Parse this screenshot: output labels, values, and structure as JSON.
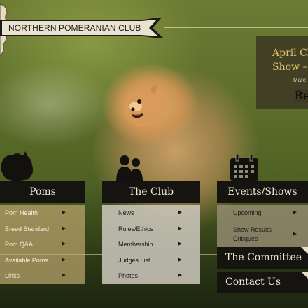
{
  "site": {
    "title": "NORTHERN POMERANIAN CLUB"
  },
  "event": {
    "title_line1": "April Ch",
    "title_line2": "Show –",
    "date": "Marc",
    "button": "Rea"
  },
  "menus": {
    "poms": {
      "label": "Poms",
      "items": [
        "Pom Health",
        "Breed Standard",
        "Pom Q&A",
        "Available Poms",
        "Links"
      ]
    },
    "club": {
      "label": "The Club",
      "items": [
        "News",
        "Rules/Ethics",
        "Membership",
        "Judges List",
        "Photos"
      ]
    },
    "events": {
      "label": "Events/Shows",
      "items": [
        "Upcoming",
        "Show Results Critiques"
      ]
    }
  },
  "blocks": {
    "committee": "The Committee",
    "contact": "Contact Us"
  },
  "arrow_glyph": "▶",
  "colors": {
    "dark": "#151410",
    "gold": "#e4c16a",
    "poms_bg": "#bea56e",
    "club_bg": "#cdc8be",
    "events_bg": "#968c73"
  },
  "icons": [
    "paw-logo-icon",
    "pomeranian-silhouette-icon",
    "people-group-icon",
    "calendar-icon"
  ]
}
